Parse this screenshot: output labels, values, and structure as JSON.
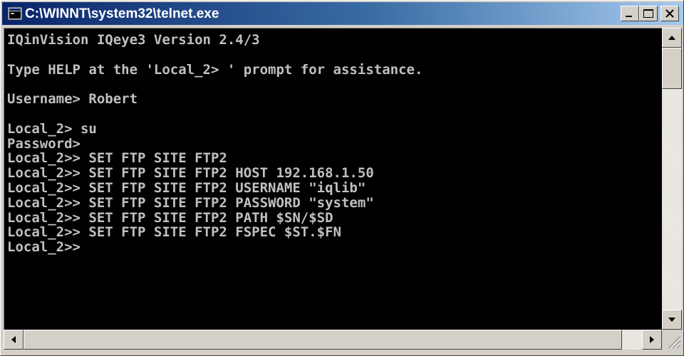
{
  "window": {
    "title": "C:\\WINNT\\system32\\telnet.exe",
    "icon": "console-window-icon",
    "titlebar_colors": [
      "#0a246a",
      "#a6caf0"
    ]
  },
  "console": {
    "background": "#000000",
    "foreground": "#c0c0c0",
    "lines": [
      "IQinVision IQeye3 Version 2.4/3",
      "",
      "Type HELP at the 'Local_2> ' prompt for assistance.",
      "",
      "Username> Robert",
      "",
      "Local_2> su",
      "Password>",
      "Local_2>> SET FTP SITE FTP2",
      "Local_2>> SET FTP SITE FTP2 HOST 192.168.1.50",
      "Local_2>> SET FTP SITE FTP2 USERNAME \"iqlib\"",
      "Local_2>> SET FTP SITE FTP2 PASSWORD \"system\"",
      "Local_2>> SET FTP SITE FTP2 PATH $SN/$SD",
      "Local_2>> SET FTP SITE FTP2 FSPEC $ST.$FN",
      "Local_2>>"
    ]
  },
  "controls": {
    "minimize": "minimize-icon",
    "maximize": "maximize-icon",
    "close": "close-icon"
  },
  "scrollbars": {
    "vertical_position": 0.0,
    "horizontal_position": 0.0
  }
}
